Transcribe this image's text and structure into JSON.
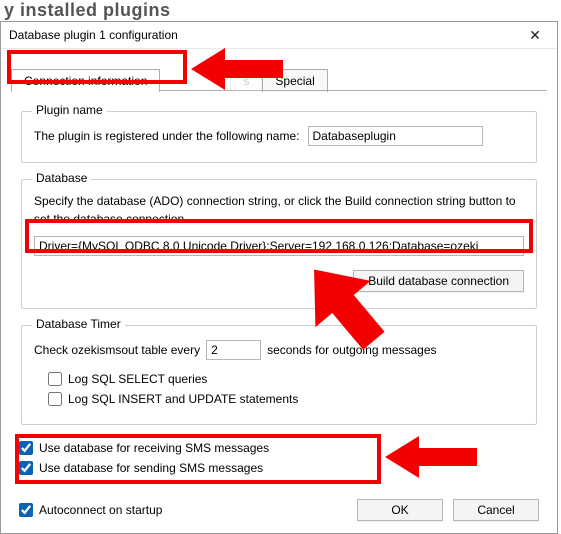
{
  "parent_window_truncated_title": "y installed plugins",
  "window": {
    "title": "Database plugin 1 configuration",
    "close_glyph": "✕"
  },
  "tabs": {
    "connection": "Connection information",
    "hidden_middle": "s",
    "special": "Special"
  },
  "plugin_name": {
    "legend": "Plugin name",
    "desc": "The plugin is registered under the following name:",
    "value": "Databaseplugin"
  },
  "database": {
    "legend": "Database",
    "desc": "Specify the database (ADO) connection string, or click the Build connection string button to set the database connection.",
    "connection_string": "Driver={MySQL ODBC 8.0 Unicode Driver};Server=192.168.0.126;Database=ozeki",
    "build_btn": "Build database connection"
  },
  "timer": {
    "legend": "Database Timer",
    "check_prefix": "Check ozekismsout table every",
    "interval": "2",
    "check_suffix": "seconds for outgoing messages",
    "log_select": "Log SQL SELECT queries",
    "log_insert_update": "Log SQL INSERT and UPDATE statements"
  },
  "use_receive": "Use database for receiving SMS messages",
  "use_send": "Use database for sending SMS messages",
  "autoconnect": "Autoconnect on startup",
  "buttons": {
    "ok": "OK",
    "cancel": "Cancel"
  }
}
